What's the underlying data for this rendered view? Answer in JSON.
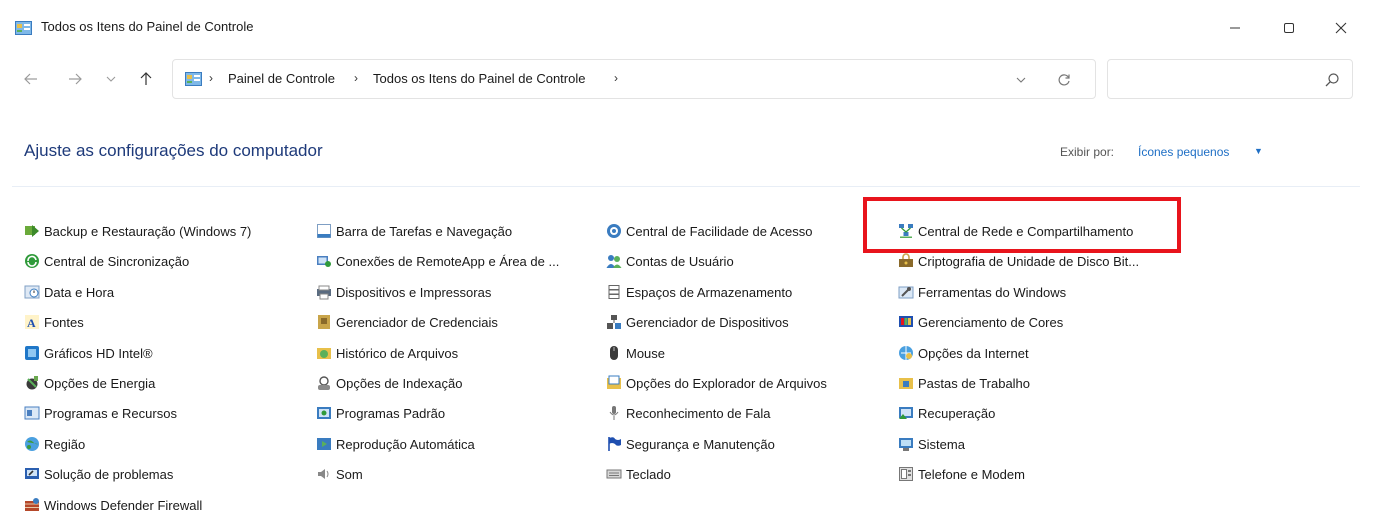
{
  "window": {
    "title": "Todos os Itens do Painel de Controle",
    "icon": "control-panel-icon"
  },
  "address": {
    "crumbs": [
      "Painel de Controle",
      "Todos os Itens do Painel de Controle"
    ],
    "search_placeholder": ""
  },
  "header": {
    "heading": "Ajuste as configurações do computador",
    "view_by_label": "Exibir por:",
    "view_by_value": "Ícones pequenos"
  },
  "items": [
    {
      "label": "Backup e Restauração (Windows 7)",
      "icon": "backup-icon"
    },
    {
      "label": "Central de Sincronização",
      "icon": "sync-icon"
    },
    {
      "label": "Data e Hora",
      "icon": "clock-icon"
    },
    {
      "label": "Fontes",
      "icon": "fonts-icon"
    },
    {
      "label": "Gráficos HD Intel®",
      "icon": "intel-graphics-icon"
    },
    {
      "label": "Opções de Energia",
      "icon": "power-icon"
    },
    {
      "label": "Programas e Recursos",
      "icon": "programs-icon"
    },
    {
      "label": "Região",
      "icon": "globe-icon"
    },
    {
      "label": "Solução de problemas",
      "icon": "troubleshoot-icon"
    },
    {
      "label": "Windows Defender Firewall",
      "icon": "firewall-icon"
    },
    {
      "label": "Barra de Tarefas e Navegação",
      "icon": "taskbar-icon"
    },
    {
      "label": "Conexões de RemoteApp e Área de ...",
      "icon": "remoteapp-icon"
    },
    {
      "label": "Dispositivos e Impressoras",
      "icon": "printer-icon"
    },
    {
      "label": "Gerenciador de Credenciais",
      "icon": "credentials-icon"
    },
    {
      "label": "Histórico de Arquivos",
      "icon": "file-history-icon"
    },
    {
      "label": "Opções de Indexação",
      "icon": "indexing-icon"
    },
    {
      "label": "Programas Padrão",
      "icon": "default-programs-icon"
    },
    {
      "label": "Reprodução Automática",
      "icon": "autoplay-icon"
    },
    {
      "label": "Som",
      "icon": "sound-icon"
    },
    {
      "label": "Central de Facilidade de Acesso",
      "icon": "accessibility-icon"
    },
    {
      "label": "Contas de Usuário",
      "icon": "user-accounts-icon"
    },
    {
      "label": "Espaços de Armazenamento",
      "icon": "storage-icon"
    },
    {
      "label": "Gerenciador de Dispositivos",
      "icon": "device-manager-icon"
    },
    {
      "label": "Mouse",
      "icon": "mouse-icon"
    },
    {
      "label": "Opções do Explorador de Arquivos",
      "icon": "folder-options-icon"
    },
    {
      "label": "Reconhecimento de Fala",
      "icon": "microphone-icon"
    },
    {
      "label": "Segurança e Manutenção",
      "icon": "flag-icon"
    },
    {
      "label": "Teclado",
      "icon": "keyboard-icon"
    },
    {
      "label": "Central de Rede e Compartilhamento",
      "icon": "network-icon"
    },
    {
      "label": "Criptografia de Unidade de Disco Bit...",
      "icon": "bitlocker-icon"
    },
    {
      "label": "Ferramentas do Windows",
      "icon": "tools-icon"
    },
    {
      "label": "Gerenciamento de Cores",
      "icon": "color-management-icon"
    },
    {
      "label": "Opções da Internet",
      "icon": "internet-options-icon"
    },
    {
      "label": "Pastas de Trabalho",
      "icon": "work-folders-icon"
    },
    {
      "label": "Recuperação",
      "icon": "recovery-icon"
    },
    {
      "label": "Sistema",
      "icon": "system-icon"
    },
    {
      "label": "Telefone e Modem",
      "icon": "phone-icon"
    }
  ],
  "colors": {
    "heading": "#1e3a7a",
    "link": "#1f6fc5",
    "highlight": "#e8141c"
  }
}
